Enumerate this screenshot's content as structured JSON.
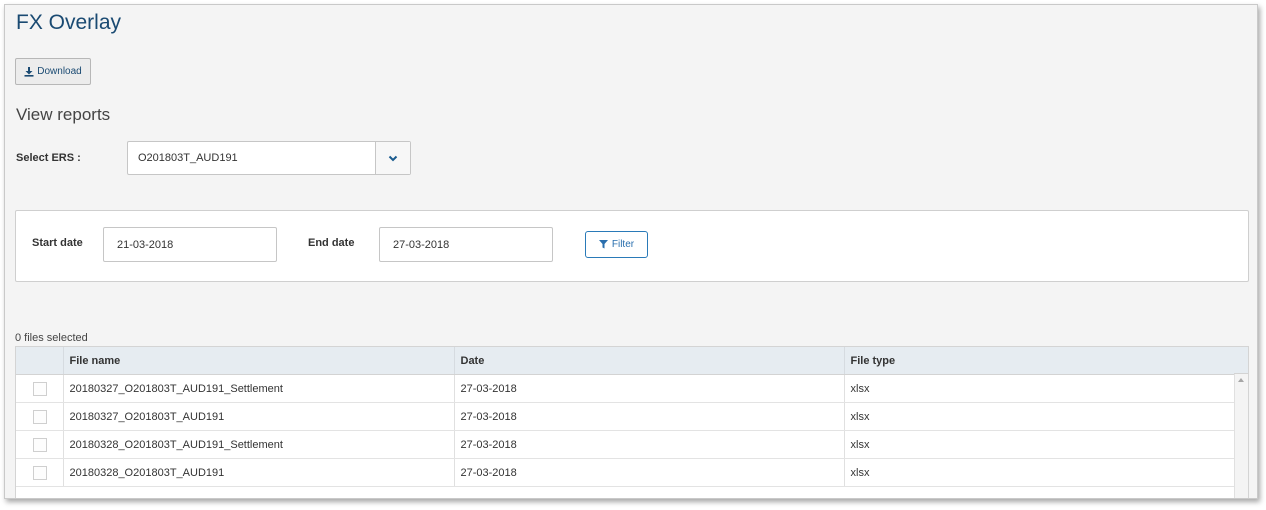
{
  "page": {
    "title": "FX Overlay"
  },
  "toolbar": {
    "download_label": "Download"
  },
  "reports": {
    "section_title": "View reports",
    "ers_label": "Select ERS :",
    "ers_selected": "O201803T_AUD191"
  },
  "filter": {
    "start_label": "Start date",
    "start_value": "21-03-2018",
    "end_label": "End date",
    "end_value": "27-03-2018",
    "button_label": "Filter"
  },
  "files": {
    "selected_count_text": "0 files selected",
    "columns": [
      "",
      "File name",
      "Date",
      "File type"
    ],
    "rows": [
      {
        "name": "20180327_O201803T_AUD191_Settlement",
        "date": "27-03-2018",
        "type": "xlsx"
      },
      {
        "name": "20180327_O201803T_AUD191",
        "date": "27-03-2018",
        "type": "xlsx"
      },
      {
        "name": "20180328_O201803T_AUD191_Settlement",
        "date": "27-03-2018",
        "type": "xlsx"
      },
      {
        "name": "20180328_O201803T_AUD191",
        "date": "27-03-2018",
        "type": "xlsx"
      }
    ]
  },
  "colors": {
    "brand_title": "#1a4a72",
    "accent": "#2a7ab8",
    "header_bg": "#e6ecf1"
  },
  "icons": {
    "download": "download-icon",
    "dropdown": "chevron-down-icon",
    "filter": "filter-icon"
  }
}
